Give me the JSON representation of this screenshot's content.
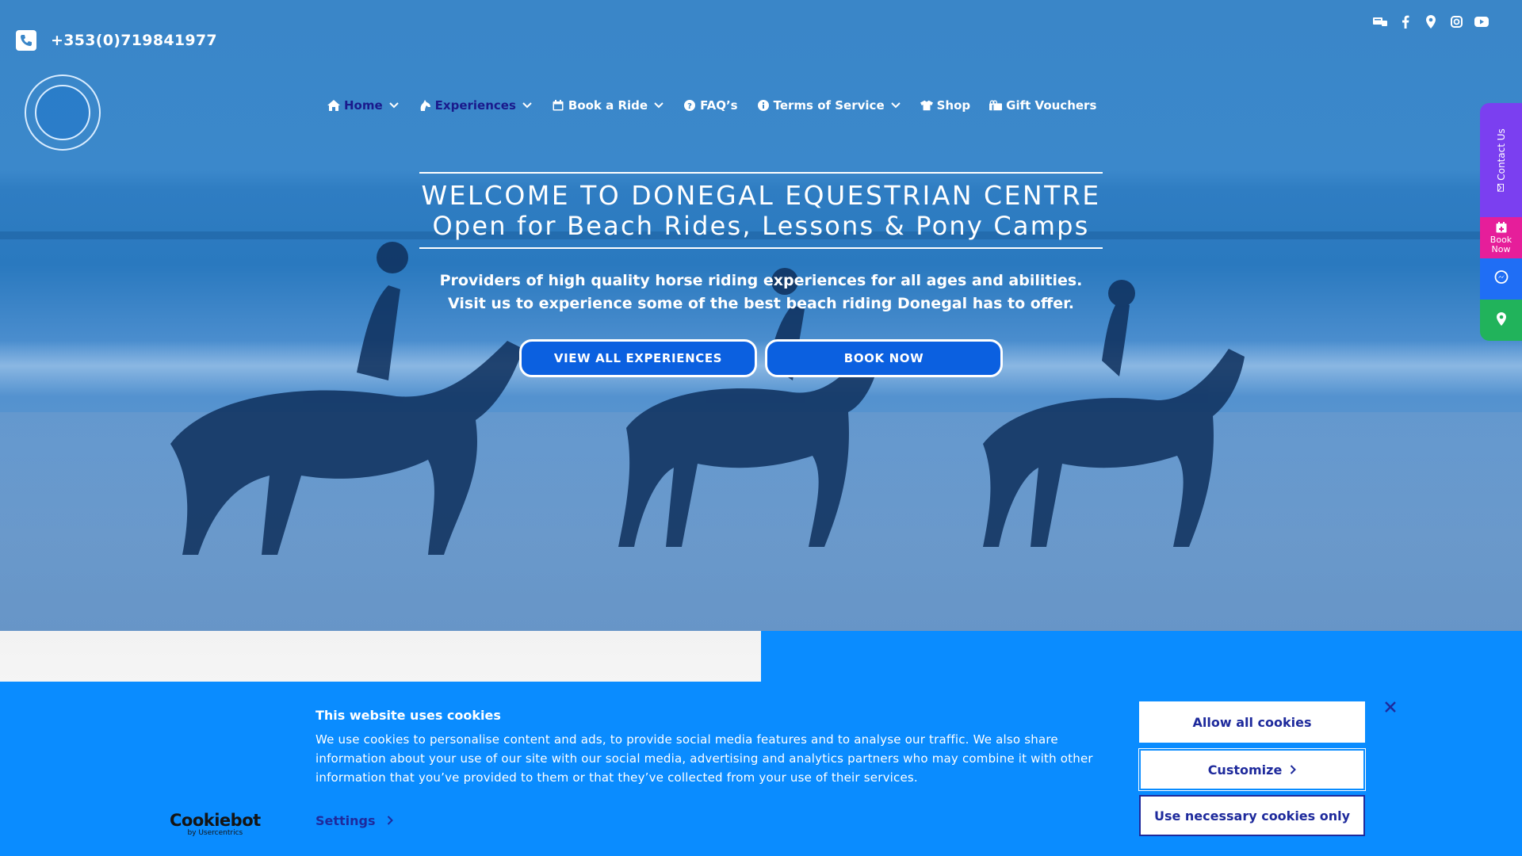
{
  "header": {
    "phone": "+353(0)719841977",
    "social_icons": [
      "tripadvisor-icon",
      "facebook-icon",
      "map-pin-icon",
      "instagram-icon",
      "youtube-icon"
    ]
  },
  "nav": {
    "items": [
      {
        "label": "Home",
        "icon": "home-icon",
        "has_dropdown": true,
        "active": true
      },
      {
        "label": "Experiences",
        "icon": "horse-icon",
        "has_dropdown": true,
        "active": true
      },
      {
        "label": "Book a Ride",
        "icon": "calendar-icon",
        "has_dropdown": true
      },
      {
        "label": "FAQ’s",
        "icon": "question-icon",
        "has_dropdown": false
      },
      {
        "label": "Terms of Service",
        "icon": "info-icon",
        "has_dropdown": true
      },
      {
        "label": "Shop",
        "icon": "shirt-icon",
        "has_dropdown": false
      },
      {
        "label": "Gift Vouchers",
        "icon": "gift-icon",
        "has_dropdown": false
      }
    ]
  },
  "hero": {
    "title": "WELCOME TO DONEGAL EQUESTRIAN CENTRE",
    "subtitle": "Open for Beach Rides, Lessons & Pony Camps",
    "tagline_line1": "Providers of high quality horse riding experiences for all ages and abilities.",
    "tagline_line2": "Visit us to experience some of the best beach riding Donegal has to offer.",
    "cta_primary": "VIEW ALL EXPERIENCES",
    "cta_secondary": "BOOK NOW"
  },
  "side_widget": {
    "contact_label": "Contact Us",
    "book_label_1": "Book",
    "book_label_2": "Now"
  },
  "cookie_banner": {
    "title": "This website uses cookies",
    "text": "We use cookies to personalise content and ads, to provide social media features and to analyse our traffic. We also share information about your use of our site with our social media, advertising and analytics partners who may combine it with other information that you’ve provided to them or that they’ve collected from your use of their services.",
    "settings_label": "Settings",
    "brand": "Cookiebot",
    "brand_sub": "by Usercentrics",
    "allow_all": "Allow all cookies",
    "customize": "Customize",
    "necessary_only": "Use necessary cookies only"
  },
  "colors": {
    "hero_tint": "#3a86c8",
    "cta_blue": "#0b60e0",
    "banner_blue": "#0a8cff",
    "nav_active": "#1a1a8c",
    "widget_purple": "#7b3ff0",
    "widget_pink": "#e61e9a",
    "widget_blue": "#1f6ef5",
    "widget_green": "#21b35b"
  }
}
